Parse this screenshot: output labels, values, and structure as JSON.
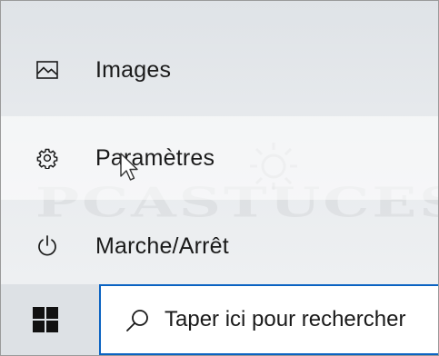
{
  "start_menu": {
    "items": [
      {
        "label": "Images",
        "icon": "picture-icon"
      },
      {
        "label": "Paramètres",
        "icon": "gear-icon"
      },
      {
        "label": "Marche/Arrêt",
        "icon": "power-icon"
      }
    ]
  },
  "watermark": {
    "text": "PCASTUCES"
  },
  "taskbar": {
    "start_icon": "windows-logo-icon",
    "search": {
      "icon": "search-icon",
      "placeholder": "Taper ici pour rechercher",
      "value": ""
    },
    "accent_color": "#0a63c2"
  }
}
